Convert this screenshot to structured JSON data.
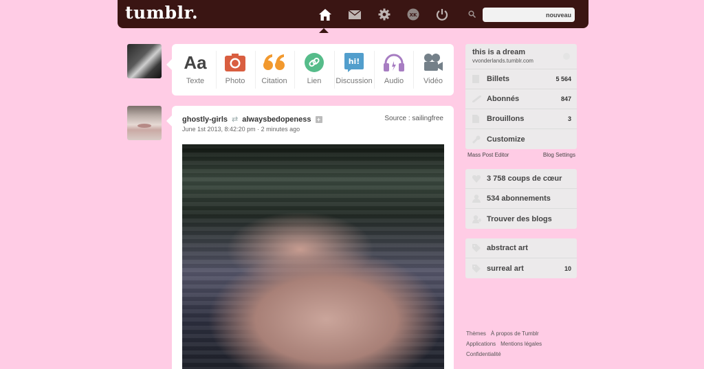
{
  "header": {
    "logo": "tumblr.",
    "nav": [
      "home-icon",
      "envelope-icon",
      "gear-icon",
      "xkit-icon",
      "power-icon"
    ],
    "search_placeholder": "nouveau"
  },
  "post_types": [
    {
      "label": "Texte",
      "icon": "Aa",
      "color": "#444444"
    },
    {
      "label": "Photo",
      "icon": "camera-icon",
      "color": "#d95e40"
    },
    {
      "label": "Citation",
      "icon": "“",
      "color": "#f2992e"
    },
    {
      "label": "Lien",
      "icon": "link-icon",
      "color": "#56bc8a"
    },
    {
      "label": "Discussion",
      "icon": "hi!",
      "color": "#529ecc"
    },
    {
      "label": "Audio",
      "icon": "headphones-icon",
      "color": "#a77dc2"
    },
    {
      "label": "Vidéo",
      "icon": "video-camera-icon",
      "color": "#748089"
    }
  ],
  "post": {
    "author": "ghostly-girls",
    "reblogged_from": "alwaysbedopeness",
    "date": "June 1st 2013, 8:42:20 pm · 2 minutes ago",
    "source": "Source : sailingfree"
  },
  "blog": {
    "title": "this is a dream",
    "url": "vvonderlands.tumblr.com",
    "rows": [
      {
        "label": "Billets",
        "count": "5 564",
        "icon": "posts-icon"
      },
      {
        "label": "Abonnés",
        "count": "847",
        "icon": "followers-icon"
      },
      {
        "label": "Brouillons",
        "count": "3",
        "icon": "drafts-icon"
      },
      {
        "label": "Customize",
        "count": "",
        "icon": "wrench-icon"
      }
    ],
    "mass_post_editor": "Mass Post Editor",
    "blog_settings": "Blog Settings"
  },
  "activity": [
    {
      "label": "3 758 coups de cœur",
      "icon": "heart-icon"
    },
    {
      "label": "534 abonnements",
      "icon": "following-icon"
    },
    {
      "label": "Trouver des blogs",
      "icon": "find-blogs-icon"
    }
  ],
  "tags": [
    {
      "label": "abstract art",
      "count": ""
    },
    {
      "label": "surreal art",
      "count": "10"
    }
  ],
  "footer": {
    "line1": [
      "Thèmes",
      "À propos de Tumblr"
    ],
    "line2": [
      "Applications",
      "Mentions légales"
    ],
    "line3": [
      "Confidentialité"
    ]
  }
}
